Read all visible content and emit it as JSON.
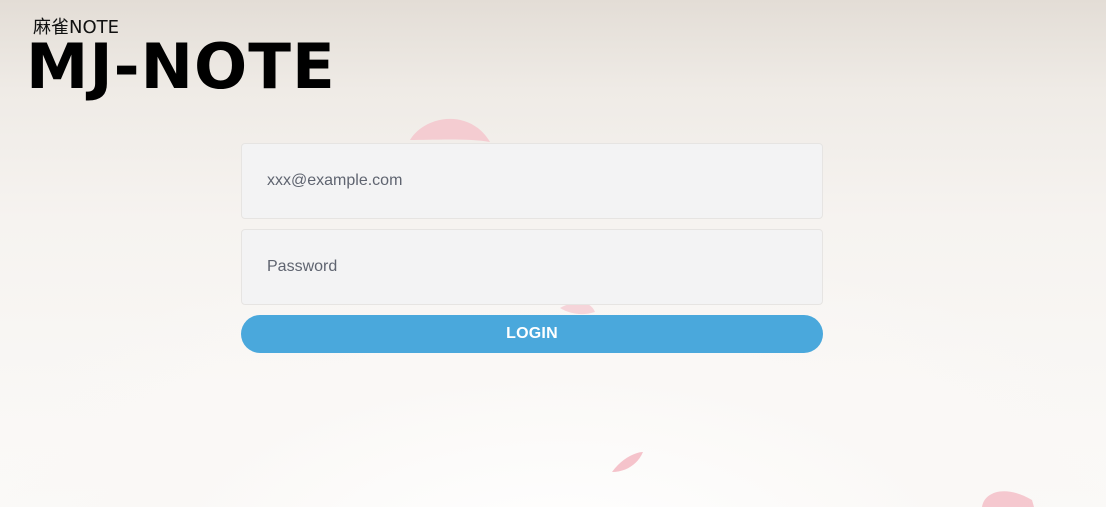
{
  "logo": {
    "sub_text": "麻雀NOTE",
    "main_text": "MJ-NOTE"
  },
  "login_form": {
    "email_placeholder": "xxx@example.com",
    "email_value": "",
    "password_placeholder": "Password",
    "password_value": "",
    "login_label": "LOGIN"
  },
  "decorations": {
    "background_image": "cherry-blossom-petals",
    "petal_color": "#f3c9cf"
  },
  "colors": {
    "accent": "#4aa8dc",
    "field_background": "#f3f3f4"
  }
}
